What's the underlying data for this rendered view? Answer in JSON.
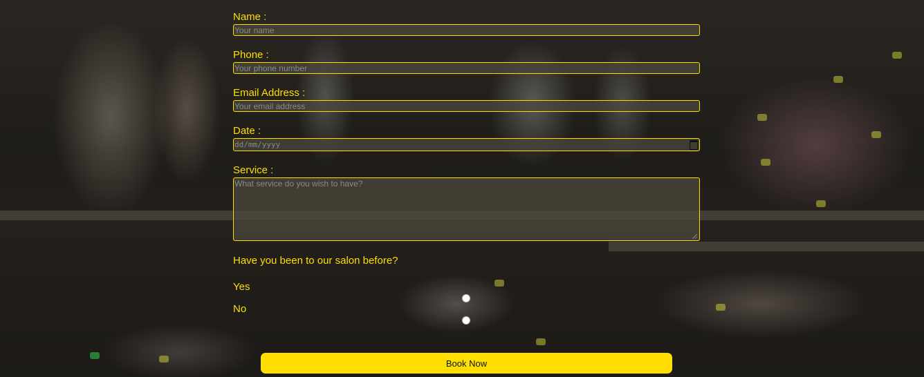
{
  "form": {
    "name": {
      "label": "Name :",
      "placeholder": "Your name"
    },
    "phone": {
      "label": "Phone :",
      "placeholder": "Your phone number"
    },
    "email": {
      "label": "Email Address :",
      "placeholder": "Your email address"
    },
    "date": {
      "label": "Date :",
      "placeholder": "dd/mm/yyyy"
    },
    "service": {
      "label": "Service :",
      "placeholder": "What service do you wish to have?"
    },
    "visited": {
      "question": "Have you been to our salon before?",
      "options": [
        {
          "label": "Yes"
        },
        {
          "label": "No"
        }
      ]
    },
    "submit_label": "Book Now"
  },
  "colors": {
    "accent": "#ffde00",
    "field_background": "#4b483c",
    "placeholder": "#8a8a86"
  },
  "icons": {
    "date_picker": "calendar-icon"
  }
}
